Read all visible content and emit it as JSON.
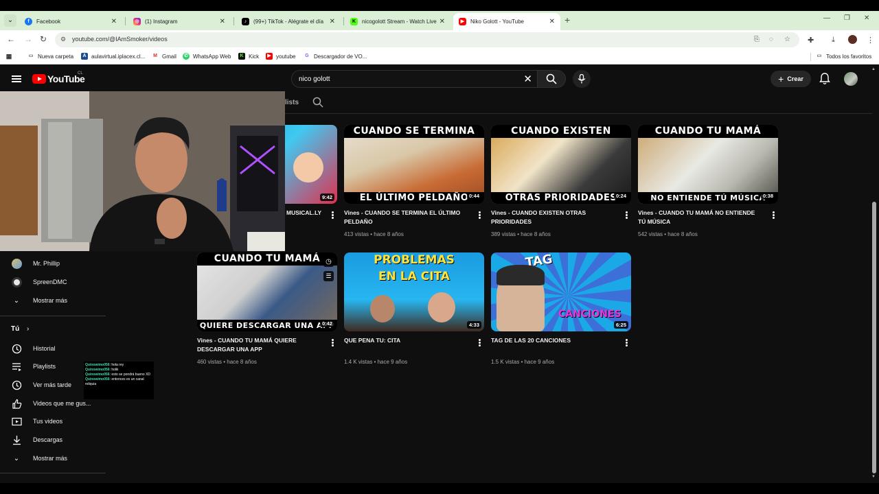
{
  "browser": {
    "tabs": [
      {
        "title": "Facebook",
        "favicon": "facebook-icon",
        "color": "#1877f2"
      },
      {
        "title": "(1) Instagram",
        "favicon": "instagram-icon",
        "color": "#d6249f"
      },
      {
        "title": "(99+) TikTok - Alégrate el día",
        "favicon": "tiktok-icon",
        "color": "#000000"
      },
      {
        "title": "nicogolott Stream - Watch Live",
        "favicon": "kick-icon",
        "color": "#53fc18"
      },
      {
        "title": "Niko Golott - YouTube",
        "favicon": "youtube-icon",
        "color": "#ff0000",
        "active": true
      }
    ],
    "url": "youtube.com/@IAmSmoker/videos",
    "bookmarks": [
      {
        "label": "Nueva carpeta",
        "icon": "folder-icon"
      },
      {
        "label": "aulavirtual.iplacex.cl...",
        "icon": "aulavirtual-icon"
      },
      {
        "label": "Gmail",
        "icon": "gmail-icon"
      },
      {
        "label": "WhatsApp Web",
        "icon": "whatsapp-icon"
      },
      {
        "label": "Kick",
        "icon": "kick-icon"
      },
      {
        "label": "youtube",
        "icon": "youtube-icon"
      },
      {
        "label": "Descargador de VO...",
        "icon": "download-icon"
      }
    ],
    "all_bookmarks_label": "Todos los favoritos"
  },
  "youtube": {
    "logo_text": "YouTube",
    "country_code": "CL",
    "search_query": "nico golott",
    "create_label": "Crear",
    "channel_tab_partial": "lists",
    "accent": "#ff0000"
  },
  "videos": [
    {
      "title": "MUSICAL.LY",
      "duration": "9:42",
      "views": "",
      "age": "",
      "cap_top": "",
      "cap_bot": ""
    },
    {
      "title": "Vines - CUANDO SE TERMINA EL ÚLTIMO PELDAÑO",
      "duration": "0:44",
      "views": "413 vistas",
      "age": "hace 8 años",
      "cap_top": "CUANDO SE TERMINA",
      "cap_bot": "EL ÚLTIMO PELDAÑO"
    },
    {
      "title": "Vines - CUANDO EXISTEN OTRAS PRIORIDADES",
      "duration": "0:24",
      "views": "389 vistas",
      "age": "hace 8 años",
      "cap_top": "CUANDO EXISTEN",
      "cap_bot": "OTRAS PRIORIDADES"
    },
    {
      "title": "Vines - CUANDO TU MAMÁ NO ENTIENDE TÚ MÚSICA",
      "duration": "0:38",
      "views": "542 vistas",
      "age": "hace 8 años",
      "cap_top": "CUANDO TU MAMÁ",
      "cap_bot": "NO ENTIENDE TÚ MÚSICA"
    },
    {
      "title": "Vines - CUANDO TU MAMÁ QUIERE DESCARGAR UNA APP",
      "duration": "0:42",
      "views": "460 vistas",
      "age": "hace 8 años",
      "cap_top": "CUANDO TU MAMÁ",
      "cap_bot": "QUIERE DESCARGAR UNA APP"
    },
    {
      "title": "QUE PENA TU: CITA",
      "duration": "4:33",
      "views": "1.4 K vistas",
      "age": "hace 9 años",
      "cap_top": "PROBLEMAS",
      "cap_bot": "EN LA CITA"
    },
    {
      "title": "TAG DE LAS 20 CANCIONES",
      "duration": "6:25",
      "views": "1.5 K vistas",
      "age": "hace 9 años",
      "cap_top": "TAG",
      "cap_bot": "CANCIONES"
    }
  ],
  "sidebar": {
    "subscriptions": [
      {
        "label": "Mr. Phillip"
      },
      {
        "label": "SpreenDMC"
      }
    ],
    "show_more_1": "Mostrar más",
    "tu_label": "Tú",
    "you_items": [
      {
        "label": "Historial",
        "icon": "history-icon"
      },
      {
        "label": "Playlists",
        "icon": "playlist-icon"
      },
      {
        "label": "Ver más tarde",
        "icon": "clock-icon"
      },
      {
        "label": "Videos que me gus...",
        "icon": "thumbs-up-icon"
      },
      {
        "label": "Tus videos",
        "icon": "video-icon"
      },
      {
        "label": "Descargas",
        "icon": "download-icon"
      }
    ],
    "show_more_2": "Mostrar más"
  },
  "chat": [
    {
      "user": "Quinowimo056",
      "msg": ": hola rey"
    },
    {
      "user": "Quinowimo056",
      "msg": ": holiii"
    },
    {
      "user": "Quinowimo056",
      "msg": ": esto se pondrá bueno XD"
    },
    {
      "user": "Quinowimo056",
      "msg": ": entonces es un canal reliquia"
    }
  ]
}
